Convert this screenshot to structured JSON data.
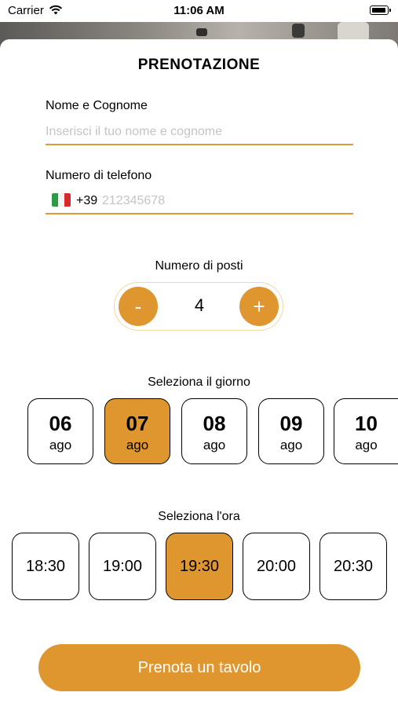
{
  "status_bar": {
    "carrier": "Carrier",
    "time": "11:06 AM"
  },
  "form": {
    "title": "PRENOTAZIONE",
    "name": {
      "label": "Nome e Cognome",
      "placeholder": "Inserisci il tuo nome e cognome"
    },
    "phone": {
      "label": "Numero di telefono",
      "prefix": "+39",
      "placeholder": "212345678"
    }
  },
  "guests": {
    "label": "Numero di posti",
    "minus": "-",
    "plus": "+",
    "value": "4"
  },
  "days": {
    "label": "Seleziona il giorno",
    "items": [
      {
        "day": "06",
        "month": "ago"
      },
      {
        "day": "07",
        "month": "ago"
      },
      {
        "day": "08",
        "month": "ago"
      },
      {
        "day": "09",
        "month": "ago"
      },
      {
        "day": "10",
        "month": "ago"
      }
    ],
    "selected": "07"
  },
  "times": {
    "label": "Seleziona l'ora",
    "items": [
      "18:30",
      "19:00",
      "19:30",
      "20:00",
      "20:30"
    ],
    "selected": "19:30"
  },
  "submit": {
    "label": "Prenota un tavolo"
  },
  "colors": {
    "accent": "#e0962f",
    "input_underline": "#e09a35",
    "placeholder": "#c4c4c6"
  }
}
